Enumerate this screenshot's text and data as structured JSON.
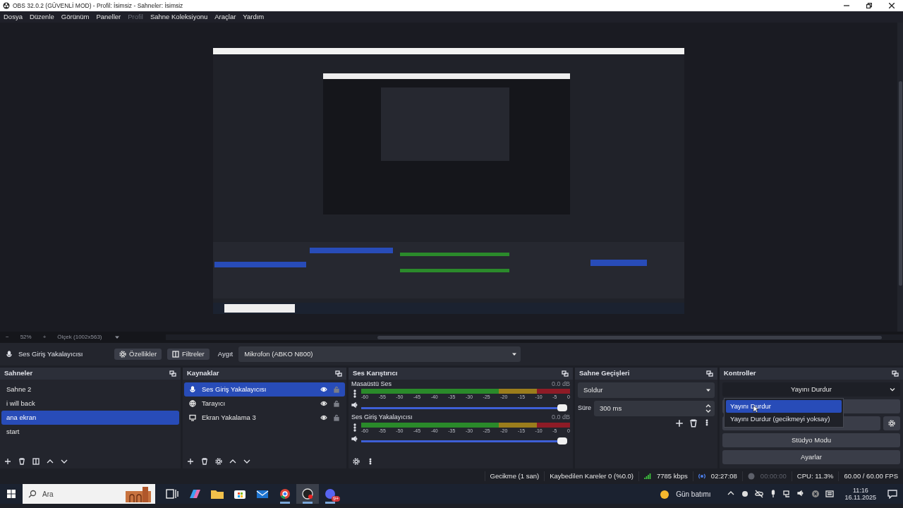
{
  "window": {
    "title": "OBS 32.0.2 (GÜVENLİ MOD) - Profil: İsimsiz - Sahneler: İsimsiz"
  },
  "menu": [
    {
      "label": "Dosya",
      "disabled": false
    },
    {
      "label": "Düzenle",
      "disabled": false
    },
    {
      "label": "Görünüm",
      "disabled": false
    },
    {
      "label": "Paneller",
      "disabled": false
    },
    {
      "label": "Profil",
      "disabled": true
    },
    {
      "label": "Sahne Koleksiyonu",
      "disabled": false
    },
    {
      "label": "Araçlar",
      "disabled": false
    },
    {
      "label": "Yardım",
      "disabled": false
    }
  ],
  "zoom_bar": {
    "minus": "−",
    "zoom": "52%",
    "plus": "+",
    "scale": "Ölçek (1002x563)"
  },
  "source_toolbar": {
    "source": "Ses Giriş Yakalayıcısı",
    "buttons": [
      "Özellikler",
      "Filtreler"
    ],
    "device_label": "Aygıt",
    "device": "Mikrofon (ABKO N800)"
  },
  "scenes": {
    "title": "Sahneler",
    "items": [
      {
        "label": "Sahne 2",
        "selected": false
      },
      {
        "label": "i will back",
        "selected": false
      },
      {
        "label": "ana ekran",
        "selected": true
      },
      {
        "label": "start",
        "selected": false
      }
    ]
  },
  "sources": {
    "title": "Kaynaklar",
    "items": [
      {
        "label": "Ses Giriş Yakalayıcısı",
        "kind": "audio",
        "selected": true
      },
      {
        "label": "Tarayıcı",
        "kind": "browser",
        "selected": false
      },
      {
        "label": "Ekran Yakalama 3",
        "kind": "display",
        "selected": false
      }
    ]
  },
  "mixer": {
    "title": "Ses Karıştırıcı",
    "channels": [
      {
        "name": "Masaüstü Ses",
        "reading": "0.0 dB",
        "level": 1.0,
        "ticks": [
          "-60",
          "-55",
          "-50",
          "-45",
          "-40",
          "-35",
          "-30",
          "-25",
          "-20",
          "-15",
          "-10",
          "-5",
          "0"
        ]
      },
      {
        "name": "Ses Giriş Yakalayıcısı",
        "reading": "0.0 dB",
        "level": 1.0,
        "ticks": [
          "-60",
          "-55",
          "-50",
          "-45",
          "-40",
          "-35",
          "-30",
          "-25",
          "-20",
          "-15",
          "-10",
          "-5",
          "0"
        ]
      }
    ]
  },
  "transitions": {
    "title": "Sahne Geçişleri",
    "transition": "Soldur",
    "duration_label": "Süre",
    "duration": "300 ms"
  },
  "controls": {
    "title": "Kontroller",
    "stream_button": "Yayını Durdur",
    "menu": [
      {
        "label": "Yayını Durdur",
        "selected": true
      },
      {
        "label": "Yayını Durdur (gecikmeyi yoksay)",
        "selected": false
      }
    ],
    "buttons": [
      "Stüdyo Modu",
      "Ayarlar"
    ]
  },
  "status_bar": [
    {
      "text": "Gecikme (1 san)",
      "kind": "plain",
      "dimmed": false
    },
    {
      "text": "Kaybedilen Kareler 0 (%0.0)",
      "kind": "plain",
      "dimmed": false
    },
    {
      "text": "7785 kbps",
      "kind": "bitrate",
      "dimmed": false
    },
    {
      "text": "02:27:08",
      "kind": "stream",
      "dimmed": false
    },
    {
      "text": "00:00:00",
      "kind": "record",
      "dimmed": true
    },
    {
      "text": "CPU: 11.3%",
      "kind": "plain",
      "dimmed": false
    },
    {
      "text": "60.00 / 60.00 FPS",
      "kind": "plain",
      "dimmed": false
    }
  ],
  "taskbar": {
    "search_placeholder": "Ara",
    "apps": [
      {
        "kind": "taskview",
        "running": false,
        "selected": false
      },
      {
        "kind": "copilot",
        "running": false,
        "selected": false
      },
      {
        "kind": "folder",
        "running": false,
        "selected": false
      },
      {
        "kind": "store",
        "running": false,
        "selected": false
      },
      {
        "kind": "mail",
        "running": false,
        "selected": false
      },
      {
        "kind": "chrome",
        "running": true,
        "selected": false
      },
      {
        "kind": "obs",
        "running": true,
        "selected": true
      },
      {
        "kind": "chat",
        "running": true,
        "selected": false,
        "badge": "9+"
      }
    ],
    "weather": "Gün batımı",
    "time": "11:16",
    "date": "16.11.2025"
  }
}
